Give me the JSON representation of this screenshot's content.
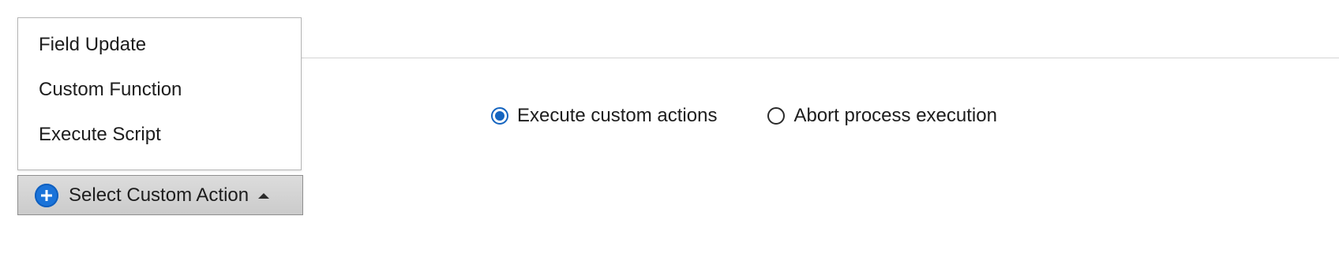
{
  "menu": {
    "items": [
      {
        "label": "Field Update"
      },
      {
        "label": "Custom Function"
      },
      {
        "label": "Execute Script"
      }
    ]
  },
  "select_button": {
    "label": "Select Custom Action",
    "icon": "plus-circle-icon",
    "caret_icon": "caret-up-icon",
    "icon_color": "#1a73d9"
  },
  "radio_group": {
    "options": [
      {
        "label": "Execute custom actions",
        "selected": true
      },
      {
        "label": "Abort process execution",
        "selected": false
      }
    ],
    "accent_color": "#1565c0"
  }
}
